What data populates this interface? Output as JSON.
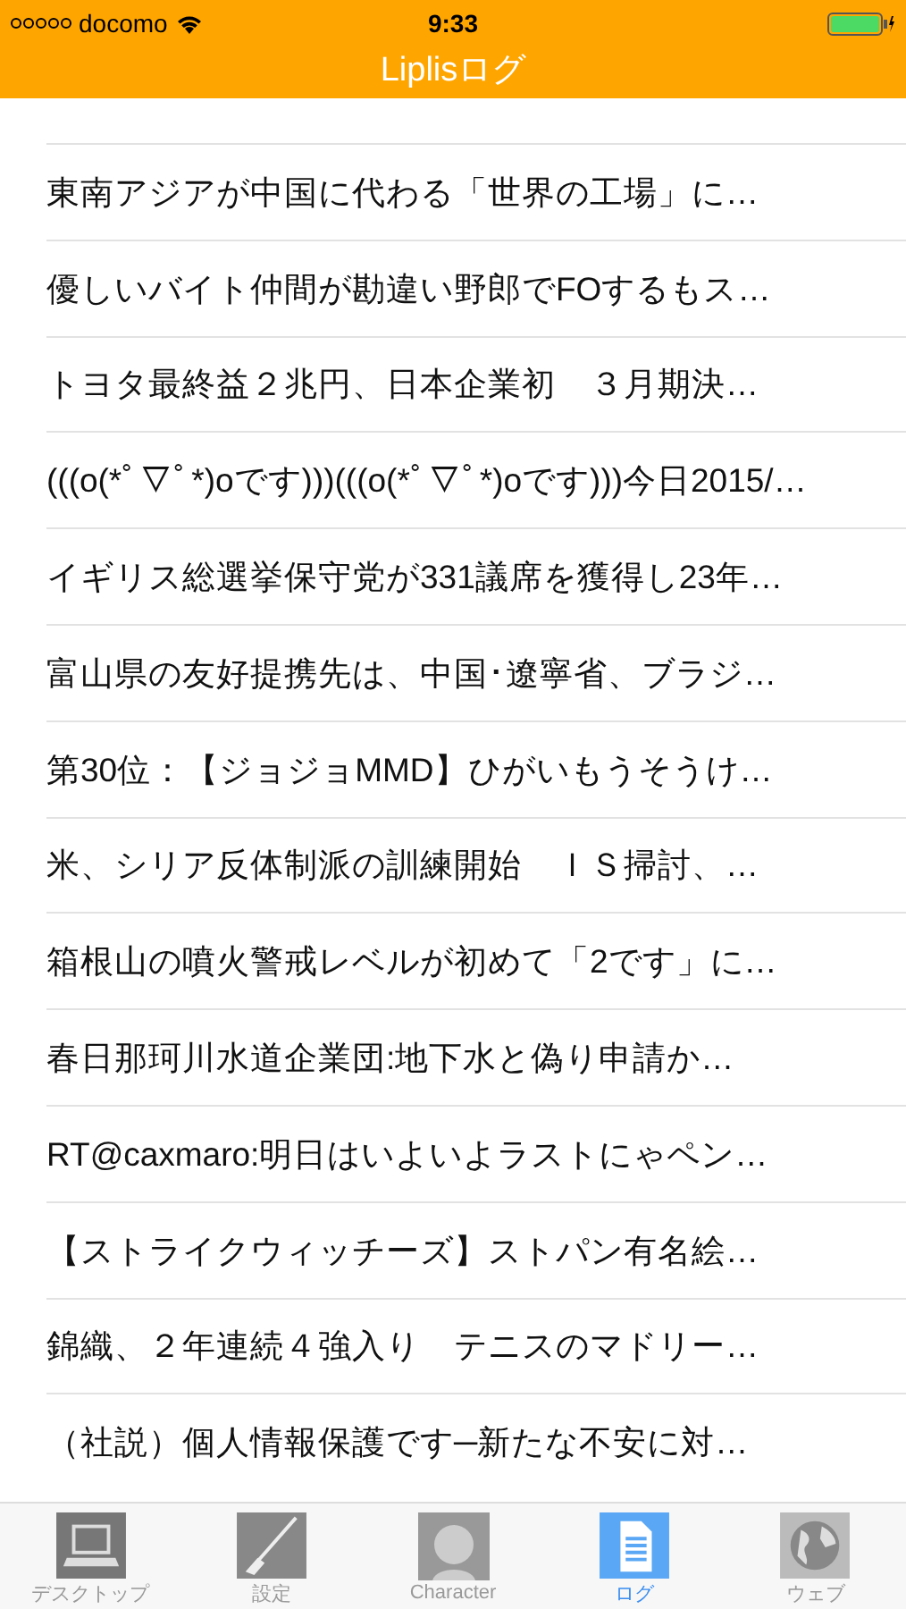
{
  "status_bar": {
    "carrier": "docomo",
    "time": "9:33"
  },
  "nav": {
    "title": "Liplisログ"
  },
  "log_items": [
    "東南アジアが中国に代わる「世界の工場」に…",
    "優しいバイト仲間が勘違い野郎でFOするもス…",
    "トヨタ最終益２兆円、日本企業初　３月期決…",
    "(((o(*ﾟ▽ﾟ*)oです)))(((o(*ﾟ▽ﾟ*)oです)))今日2015/…",
    "イギリス総選挙保守党が331議席を獲得し23年…",
    "富山県の友好提携先は、中国･遼寧省、ブラジ…",
    "第30位：【ジョジョMMD】ひがいもうそうけ…",
    "米、シリア反体制派の訓練開始　ＩＳ掃討、…",
    "箱根山の噴火警戒レベルが初めて「2です」に…",
    "春日那珂川水道企業団:地下水と偽り申請か…",
    "RT@caxmaro:明日はいよいよラストにゃペン…",
    "【ストライクウィッチーズ】ストパン有名絵…",
    "錦織、２年連続４強入り　テニスのマドリー…",
    "（社説）個人情報保護です─新たな不安に対…"
  ],
  "tabs": [
    {
      "kind": "desktop",
      "label": "デスクトップ",
      "selected": false
    },
    {
      "kind": "settings",
      "label": "設定",
      "selected": false
    },
    {
      "kind": "character",
      "label": "Character",
      "selected": false
    },
    {
      "kind": "log",
      "label": "ログ",
      "selected": true
    },
    {
      "kind": "web",
      "label": "ウェブ",
      "selected": false
    }
  ]
}
